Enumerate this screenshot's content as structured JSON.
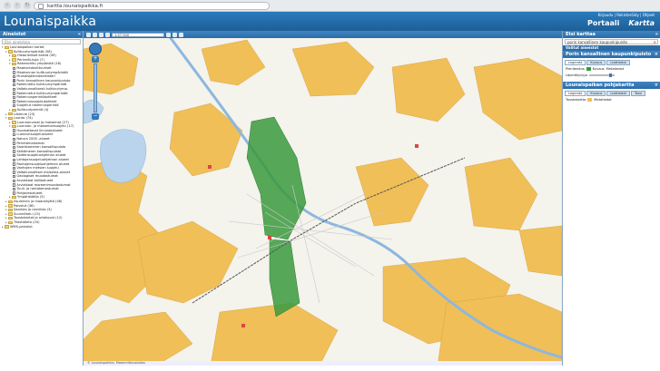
{
  "browser": {
    "url": "kartta.lounaispaikka.fi"
  },
  "header": {
    "logo": "Lounaispaikka",
    "links": "Kirjaudu | Rekisteröidy | Ohjeet",
    "tabs": [
      {
        "label": "Portaali"
      },
      {
        "label": "Kartta"
      }
    ]
  },
  "left_panel": {
    "title": "Aineistot",
    "search_placeholder": "Etsi aineistoja",
    "tree": [
      {
        "label": "Lounaispaikan kartat",
        "level": 0,
        "type": "folder",
        "toggle": "▾"
      },
      {
        "label": "Kulttuuriympäristö (58)",
        "level": 1,
        "type": "folder",
        "toggle": "▾"
      },
      {
        "label": "Historialliset kartat (49)",
        "level": 2,
        "type": "folder",
        "toggle": "▸"
      },
      {
        "label": "Perinnöt-kuja (7)",
        "level": 2,
        "type": "folder",
        "toggle": "▸"
      },
      {
        "label": "Rakennettu ympäristö (16)",
        "level": 2,
        "type": "folder",
        "toggle": "▾"
      },
      {
        "label": "Maakuntakulttuuriset",
        "level": 3,
        "type": "check",
        "on": false
      },
      {
        "label": "Maakunnan kulttuuriympäristöt",
        "level": 3,
        "type": "check",
        "on": false
      },
      {
        "label": "Muinaisjäännösrekisteri",
        "level": 3,
        "type": "check",
        "on": false
      },
      {
        "label": "Porin kansallinen kaupunkipuisto",
        "level": 3,
        "type": "check",
        "on": true
      },
      {
        "label": "Rakennettu kulttuuriympäristö",
        "level": 3,
        "type": "check",
        "on": false
      },
      {
        "label": "Valtakunnallisesti kulttuuriymp.",
        "level": 3,
        "type": "check",
        "on": false
      },
      {
        "label": "Rakennetut kulttuuriympäristöt",
        "level": 3,
        "type": "check",
        "on": false
      },
      {
        "label": "Rakennusperintökohteet",
        "level": 3,
        "type": "check",
        "on": false
      },
      {
        "label": "Rakennussuojelukohteet",
        "level": 3,
        "type": "check",
        "on": false
      },
      {
        "label": "Suojellut rakennusperintö",
        "level": 3,
        "type": "check",
        "on": false
      },
      {
        "label": "Kulttuuriperintö (4)",
        "level": 2,
        "type": "folder",
        "toggle": "▸"
      },
      {
        "label": "Liikenne (23)",
        "level": 1,
        "type": "folder",
        "toggle": "▸"
      },
      {
        "label": "Luonto (74)",
        "level": 1,
        "type": "folder",
        "toggle": "▾"
      },
      {
        "label": "Luonnonvarat ja maisemat (27)",
        "level": 2,
        "type": "folder",
        "toggle": "▸"
      },
      {
        "label": "Luonnon- ja maisemansuojelu (17)",
        "level": 2,
        "type": "folder",
        "toggle": "▾"
      },
      {
        "label": "Huomattavat linnustoalueet",
        "level": 3,
        "type": "check",
        "on": false
      },
      {
        "label": "Luonnonsuojelualueet",
        "level": 3,
        "type": "check",
        "on": false
      },
      {
        "label": "Natura 2000 -alueet",
        "level": 3,
        "type": "check",
        "on": false
      },
      {
        "label": "Perintömaisemat",
        "level": 3,
        "type": "check",
        "on": false
      },
      {
        "label": "Saaristomeren kansallispuisto",
        "level": 3,
        "type": "check",
        "on": false
      },
      {
        "label": "Selkämeren kansallispuisto",
        "level": 3,
        "type": "check",
        "on": false
      },
      {
        "label": "Soidensuojeluohjelman alueet",
        "level": 3,
        "type": "check",
        "on": false
      },
      {
        "label": "Lehtojensuojeluohjelman alueet",
        "level": 3,
        "type": "check",
        "on": false
      },
      {
        "label": "Rantojensuojeluohjelman alueet",
        "level": 3,
        "type": "check",
        "on": false
      },
      {
        "label": "Vanhojen metsien suojelu",
        "level": 3,
        "type": "check",
        "on": false
      },
      {
        "label": "Valtakunnalliset maisema-alueet",
        "level": 3,
        "type": "check",
        "on": false
      },
      {
        "label": "Geologiset muodostumat",
        "level": 3,
        "type": "check",
        "on": false
      },
      {
        "label": "Arvokkaat kallioalueet",
        "level": 3,
        "type": "check",
        "on": false
      },
      {
        "label": "Arvokkaat moreenimuodostumat",
        "level": 3,
        "type": "check",
        "on": false
      },
      {
        "label": "Tuuli- ja rantakerrostumat",
        "level": 3,
        "type": "check",
        "on": false
      },
      {
        "label": "Pohjavesialueet",
        "level": 3,
        "type": "check",
        "on": false
      },
      {
        "label": "Ympäristötila (5)",
        "level": 2,
        "type": "folder",
        "toggle": "▸"
      },
      {
        "label": "Asuminen ja maankäyttö (46)",
        "level": 1,
        "type": "folder",
        "toggle": "▸"
      },
      {
        "label": "Palvelut (36)",
        "level": 1,
        "type": "folder",
        "toggle": "▸"
      },
      {
        "label": "Saaristo ja rannikko (3)",
        "level": 1,
        "type": "folder",
        "toggle": "▸"
      },
      {
        "label": "Suunnittelu (15)",
        "level": 1,
        "type": "folder",
        "toggle": "▸"
      },
      {
        "label": "Taustakartat ja ortokuvat (12)",
        "level": 1,
        "type": "folder",
        "toggle": "▸"
      },
      {
        "label": "Tilastotieto (20)",
        "level": 1,
        "type": "folder",
        "toggle": "▸"
      },
      {
        "label": "WMS-palvelut",
        "level": 0,
        "type": "folder",
        "toggle": "▸"
      }
    ]
  },
  "map": {
    "scale_value": "1:57 000",
    "footer": "© Lounaispaikka, Maanmittauslaitos"
  },
  "right_panel": {
    "title": "Etsi karttaa",
    "search_value": "porin kansallinen kaupunkipuisto",
    "selected_header": "Valitut aineistot",
    "layer1": {
      "title": "Porin kansallinen kaupunkipuisto",
      "tabs": [
        "Legenda",
        "Kuvaus",
        "Lisätiedot"
      ],
      "rows": [
        {
          "label": "Pienikeskus",
          "desc": "Kuvaus",
          "extra": "Metatiedot"
        },
        {
          "label": "Läpinäkyvyys",
          "desc": "",
          "extra": ""
        }
      ]
    },
    "layer2": {
      "title": "Lounaispaikan pohjakartta",
      "tabs": [
        "Legenda",
        "Kuvaus",
        "Lisätiedot",
        "Taso"
      ],
      "rows": [
        {
          "label": "Taustakartta",
          "desc": "Metatiedot",
          "extra": ""
        }
      ]
    },
    "colors": {
      "park_green": "#3a9a3e",
      "header_blue": "#2a7bbd",
      "map_yellow": "#f0bf58"
    }
  }
}
